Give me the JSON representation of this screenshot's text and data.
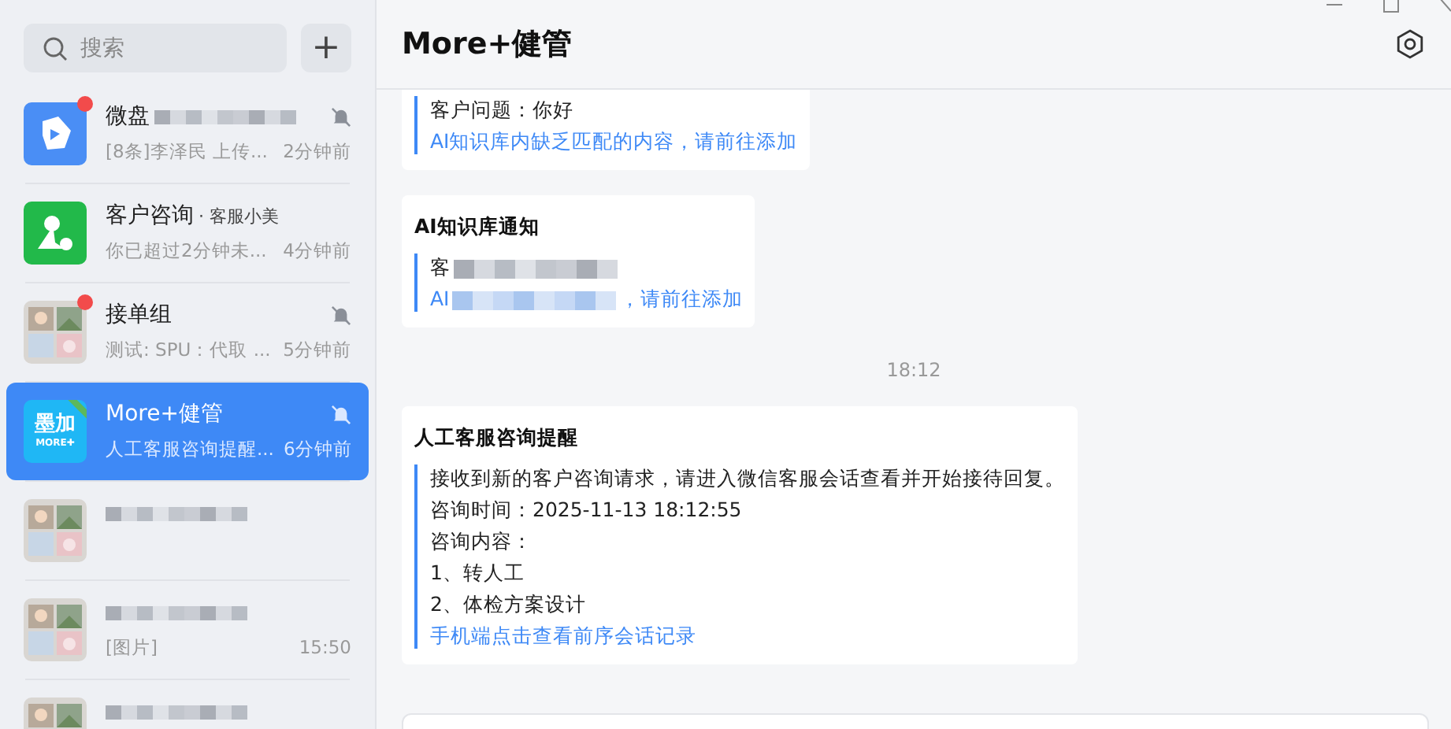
{
  "search": {
    "placeholder": "搜索"
  },
  "add_button": {
    "label": "+"
  },
  "chats": [
    {
      "name": "微盘",
      "preview": "[8条]李泽民 上传...",
      "time": "2分钟前",
      "muted": true,
      "unread": true,
      "selected": false,
      "redacted": true,
      "avatar": {
        "kind": "drive"
      }
    },
    {
      "name": "客户咨询",
      "subtitle": "· 客服小美",
      "preview": "你已超过2分钟未...",
      "time": "4分钟前",
      "muted": false,
      "unread": false,
      "selected": false,
      "redacted": false,
      "avatar": {
        "kind": "customer"
      }
    },
    {
      "name": "接单组",
      "preview": "测试: SPU：代取 ...",
      "time": "5分钟前",
      "muted": true,
      "unread": true,
      "selected": false,
      "redacted": false
    },
    {
      "name": "More+健管",
      "preview": "人工客服咨询提醒...",
      "time": "6分钟前",
      "muted": true,
      "unread": false,
      "selected": true,
      "redacted": false,
      "avatar": {
        "kind": "brand",
        "title": "墨加",
        "subtitle": "MORE✚"
      }
    },
    {
      "muted": false,
      "unread": false,
      "selected": false,
      "redacted": true
    },
    {
      "preview": "[图片]",
      "time": "15:50",
      "muted": false,
      "unread": false,
      "selected": false,
      "redacted": true
    },
    {
      "muted": false,
      "unread": false,
      "selected": false,
      "redacted": true
    }
  ],
  "conversation": {
    "title": "More+健管",
    "messages": [
      {
        "kind": "card",
        "lines": [
          {
            "kind": "plain",
            "text": "客户问题：你好",
            "redacted": false
          },
          {
            "kind": "link",
            "text": "AI知识库内缺乏匹配的内容，请前往添加",
            "redacted": false
          }
        ]
      },
      {
        "kind": "card",
        "title": "AI知识库通知",
        "lines": [
          {
            "kind": "plain",
            "text": "客",
            "redacted": true
          },
          {
            "kind": "link",
            "text": "AI",
            "redacted": true,
            "tail": "，请前往添加"
          }
        ]
      },
      {
        "kind": "time",
        "text": "18:12"
      },
      {
        "kind": "card",
        "title": "人工客服咨询提醒",
        "lines": [
          {
            "kind": "plain",
            "text": "接收到新的客户咨询请求，请进入微信客服会话查看并开始接待回复。",
            "redacted": false
          },
          {
            "kind": "plain",
            "text": "咨询时间：2025-11-13 18:12:55",
            "redacted": false
          },
          {
            "kind": "plain",
            "text": "咨询内容：",
            "redacted": false
          },
          {
            "kind": "plain",
            "text": "1、转人工",
            "redacted": false
          },
          {
            "kind": "plain",
            "text": "2、体检方案设计",
            "redacted": false
          },
          {
            "kind": "link",
            "text": "手机端点击查看前序会话记录",
            "redacted": false
          }
        ]
      }
    ]
  }
}
